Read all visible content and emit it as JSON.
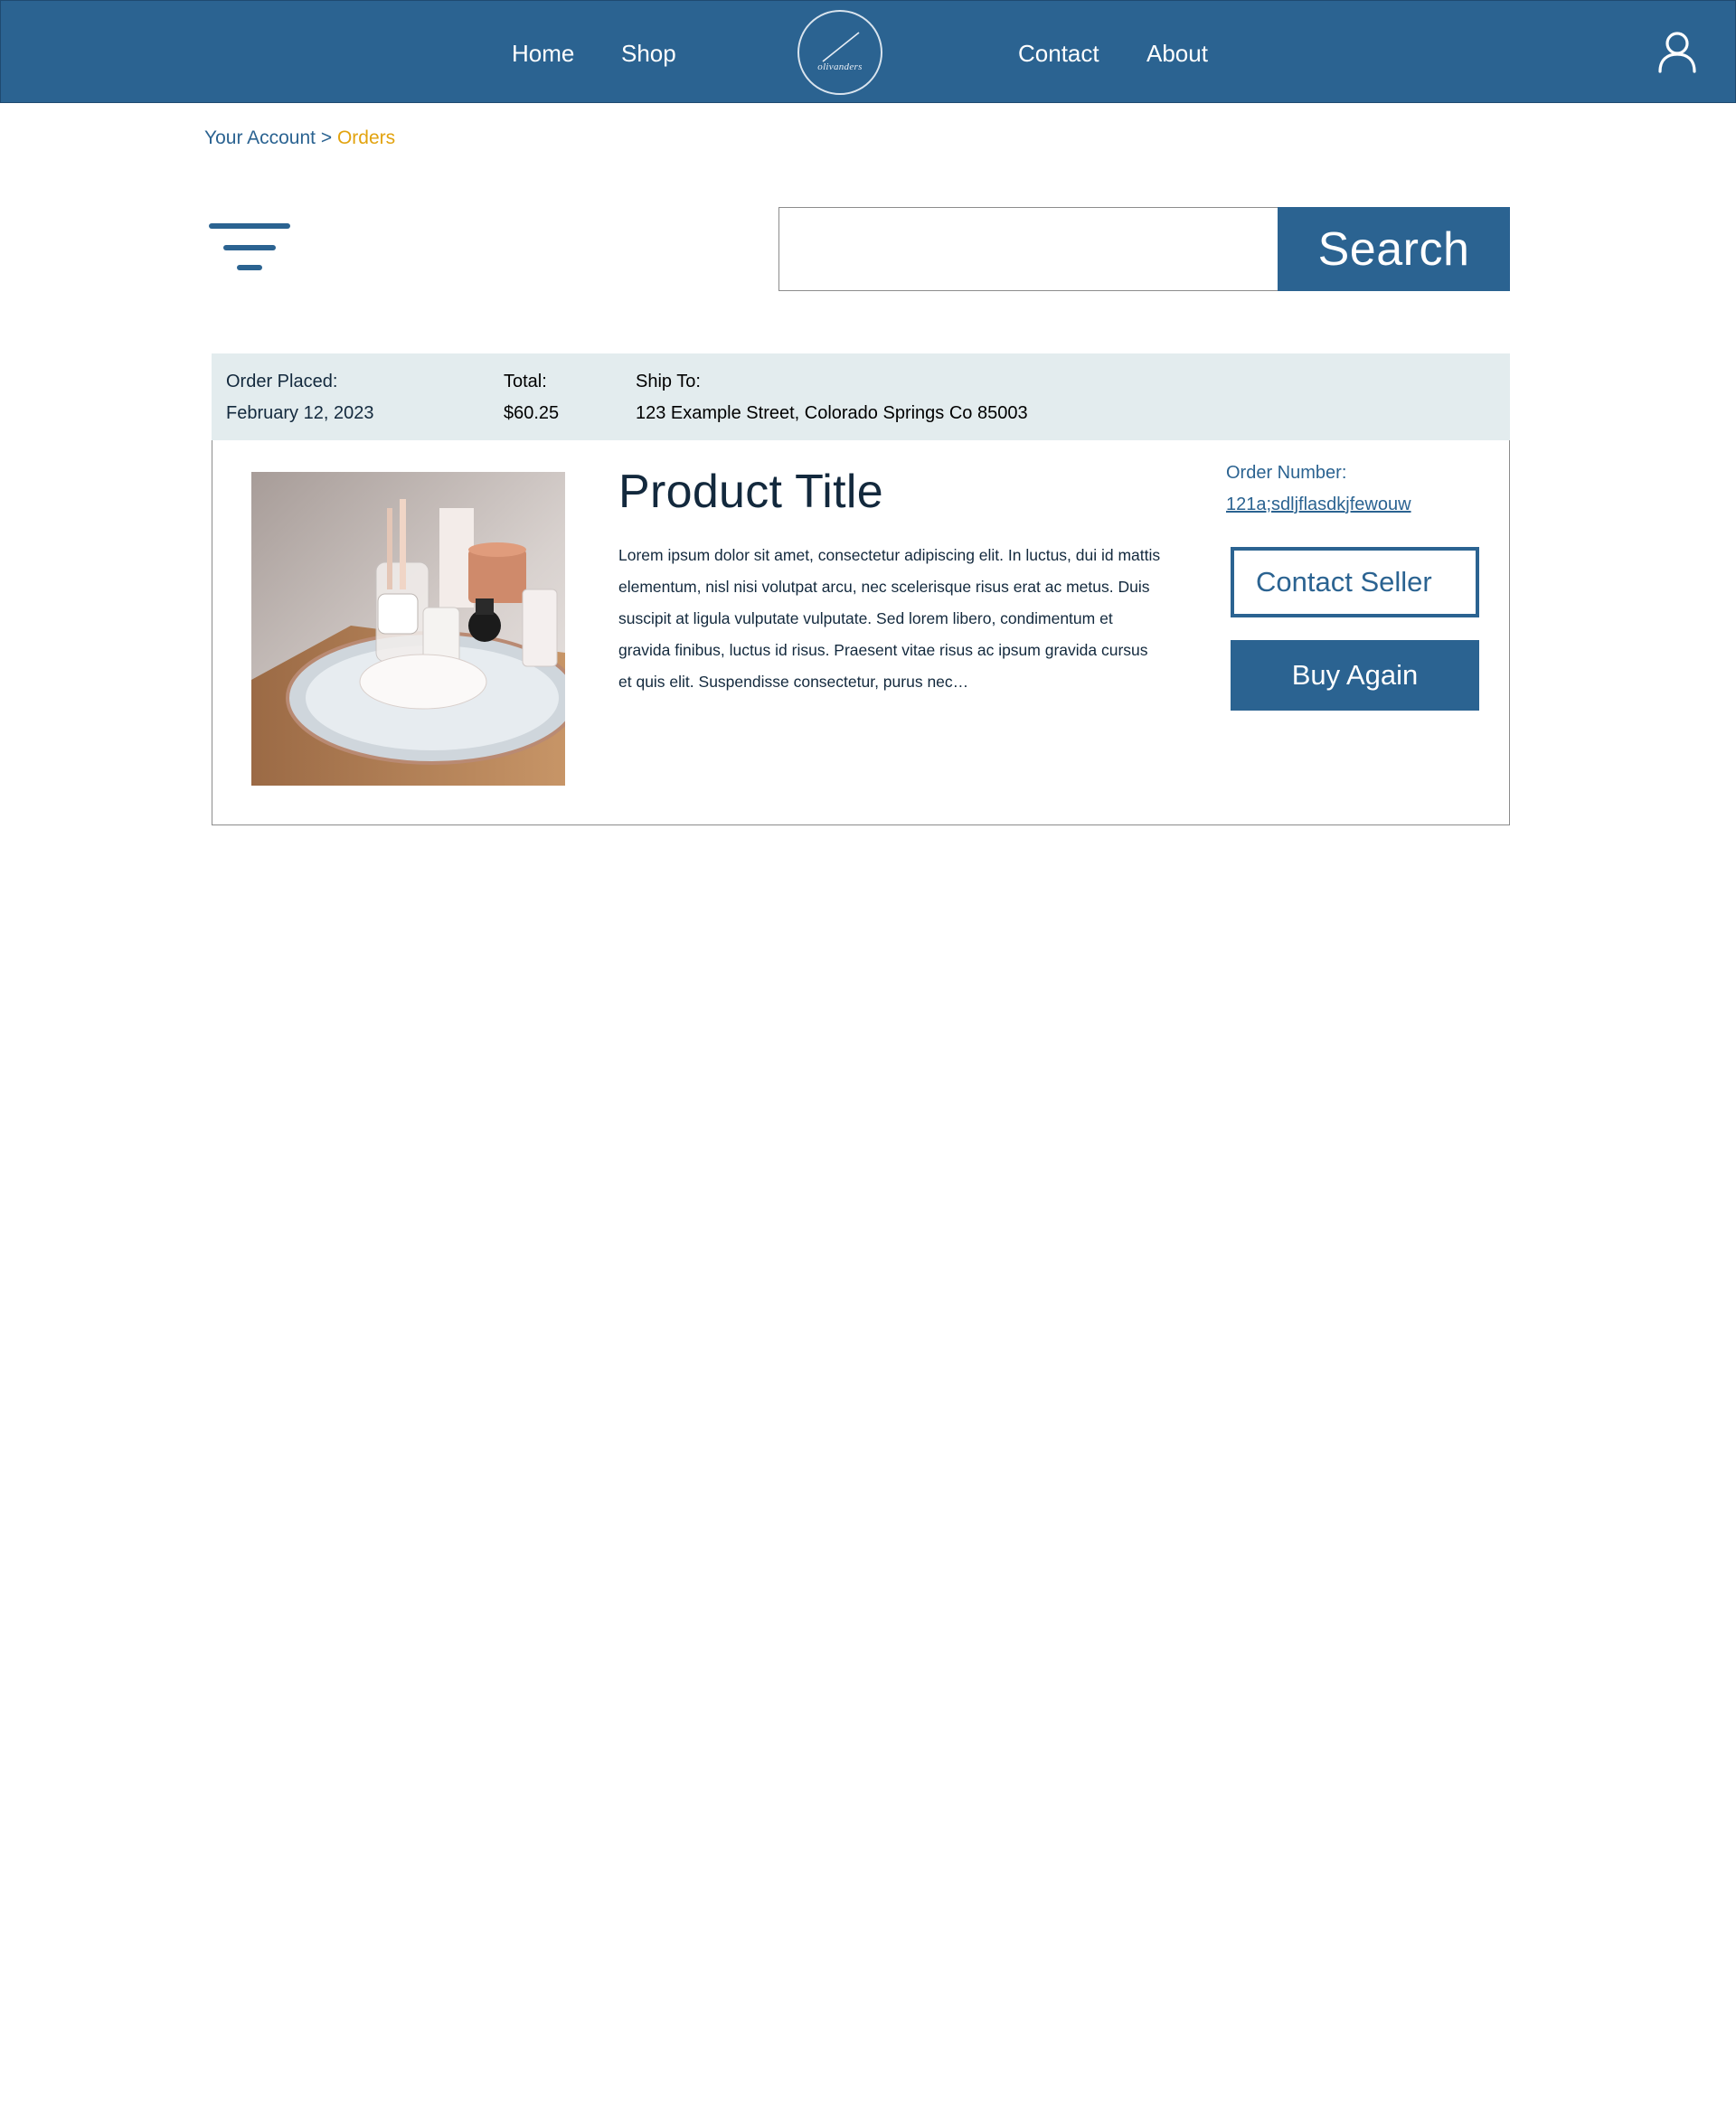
{
  "header": {
    "nav_left": [
      "Home",
      "Shop"
    ],
    "nav_right": [
      "Contact",
      "About"
    ],
    "logo_text": "olivanders",
    "user_icon": "user-icon",
    "brand_color": "#2b6391"
  },
  "breadcrumb": {
    "parent": "Your Account",
    "separator": ">",
    "current": "Orders",
    "current_color": "#e2a30f"
  },
  "toolbar": {
    "filter_icon": "filter-icon",
    "search_value": "",
    "search_placeholder": "",
    "search_label": "Search"
  },
  "order": {
    "placed_label": "Order Placed:",
    "placed_date": "February 12, 2023",
    "total_label": "Total:",
    "total_value": "$60.25",
    "ship_label": "Ship To:",
    "ship_address": "123 Example Street, Colorado Springs Co 85003",
    "product_title": "Product Title",
    "product_description": "Lorem ipsum dolor sit amet, consectetur adipiscing elit. In luctus, dui id mattis elementum, nisl nisi volutpat arcu, nec scelerisque risus erat ac metus. Duis suscipit at ligula vulputate vulputate. Sed lorem libero, condimentum et gravida finibus, luctus id risus. Praesent vitae risus ac ipsum gravida cursus et quis elit. Suspendisse consectetur, purus nec…",
    "order_number_label": "Order Number:",
    "order_number": "121a;sdljflasdkjfewouw",
    "contact_seller_label": "Contact Seller",
    "buy_again_label": "Buy Again"
  }
}
